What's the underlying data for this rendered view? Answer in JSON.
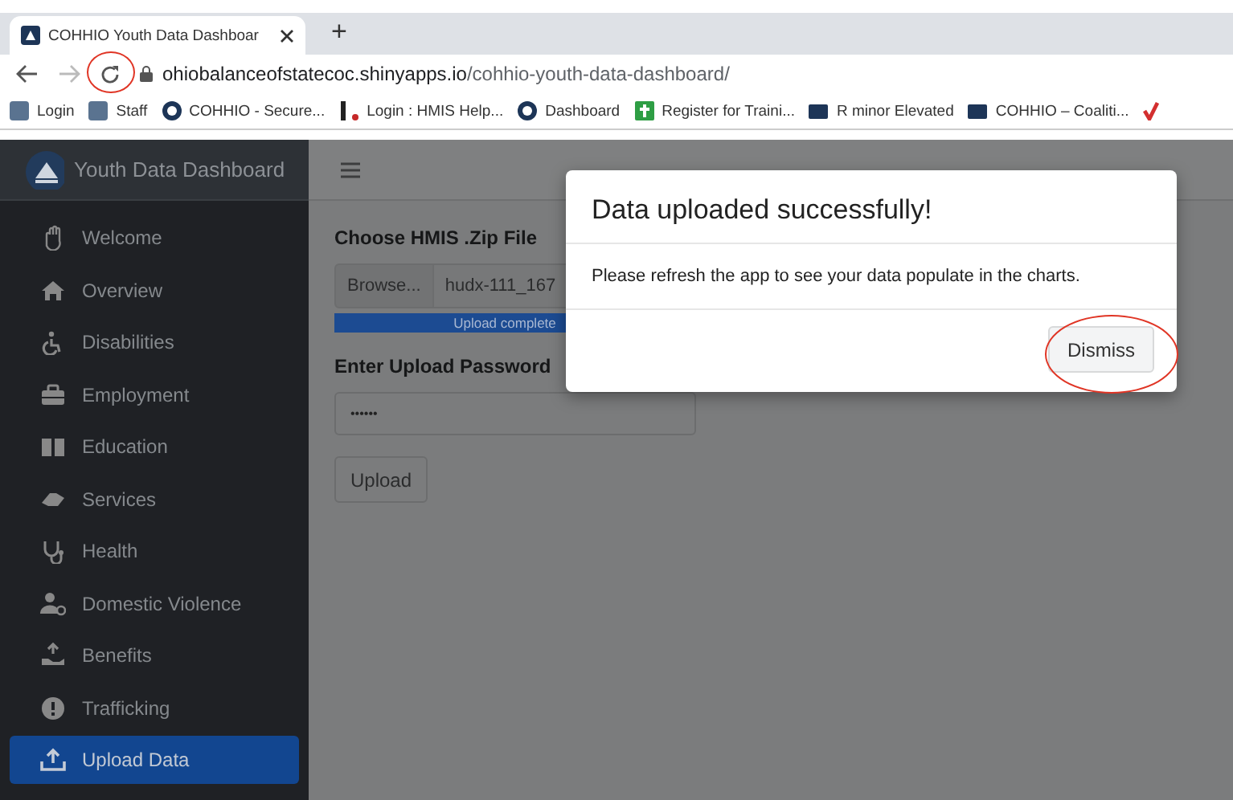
{
  "browser": {
    "tabs": [
      {
        "title": "COHHIO Youth Data Dashboar",
        "selected": true
      }
    ],
    "new_tab": "+",
    "address": {
      "host": "ohiobalanceofstatecoc.shinyapps.io",
      "path": "/cohhio-youth-data-dashboard/"
    },
    "bookmarks": [
      "Login",
      "Staff",
      "COHHIO - Secure...",
      "Login : HMIS Help...",
      "Dashboard",
      "Register for Traini...",
      "R minor Elevated",
      "COHHIO – Coaliti..."
    ]
  },
  "sidebar": {
    "title": "Youth Data Dashboard",
    "items": [
      {
        "label": "Welcome",
        "selected": false
      },
      {
        "label": "Overview",
        "selected": false
      },
      {
        "label": "Disabilities",
        "selected": false
      },
      {
        "label": "Employment",
        "selected": false
      },
      {
        "label": "Education",
        "selected": false
      },
      {
        "label": "Services",
        "selected": false
      },
      {
        "label": "Health",
        "selected": false
      },
      {
        "label": "Domestic Violence",
        "selected": false
      },
      {
        "label": "Benefits",
        "selected": false
      },
      {
        "label": "Trafficking",
        "selected": false
      },
      {
        "label": "Upload Data",
        "selected": true
      }
    ]
  },
  "form": {
    "file_label": "Choose HMIS .Zip File",
    "browse": "Browse...",
    "file_name": "hudx-111_167",
    "progress": {
      "level": 1,
      "text": "Upload complete"
    },
    "password_label": "Enter Upload Password",
    "password": "••••••",
    "submit": "Upload"
  },
  "modal": {
    "title": "Data uploaded successfully!",
    "body": "Please refresh the app to see your data populate in the charts.",
    "button": "Dismiss"
  }
}
